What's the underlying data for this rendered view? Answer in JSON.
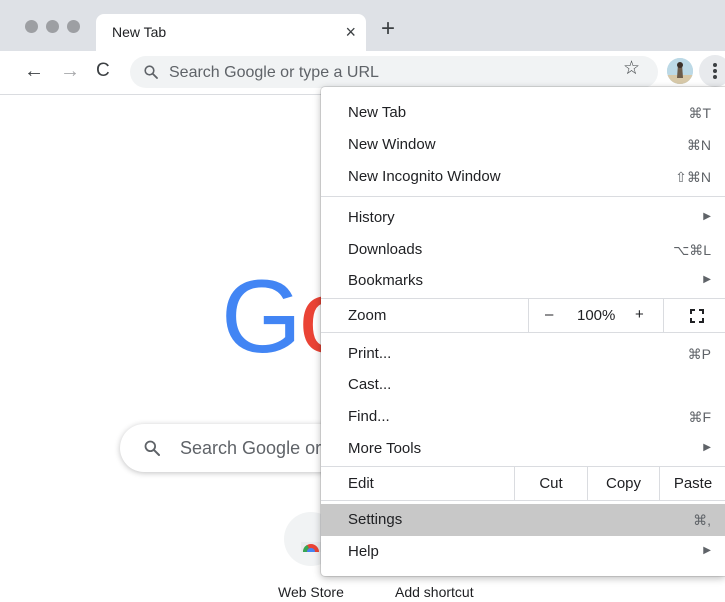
{
  "tab": {
    "title": "New Tab",
    "close": "×",
    "new_tab": "+"
  },
  "toolbar": {
    "back": "←",
    "forward": "→",
    "reload": "C",
    "omnibox_placeholder": "Search Google or type a URL",
    "star": "☆"
  },
  "ntp": {
    "logo_letters": [
      "G",
      "o"
    ],
    "search_placeholder": "Search Google or type a URL",
    "shortcuts": [
      {
        "label": "Web Store"
      },
      {
        "label": "Add shortcut"
      }
    ]
  },
  "menu": {
    "group1": [
      {
        "label": "New Tab",
        "shortcut": "⌘T"
      },
      {
        "label": "New Window",
        "shortcut": "⌘N"
      },
      {
        "label": "New Incognito Window",
        "shortcut": "⇧⌘N"
      }
    ],
    "group2": [
      {
        "label": "History",
        "arrow": "▶"
      },
      {
        "label": "Downloads",
        "shortcut": "⌥⌘L"
      },
      {
        "label": "Bookmarks",
        "arrow": "▶"
      }
    ],
    "zoom": {
      "label": "Zoom",
      "minus": "–",
      "value": "100%",
      "plus": "+"
    },
    "group3": [
      {
        "label": "Print...",
        "shortcut": "⌘P"
      },
      {
        "label": "Cast..."
      },
      {
        "label": "Find...",
        "shortcut": "⌘F"
      },
      {
        "label": "More Tools",
        "arrow": "▶"
      }
    ],
    "edit": {
      "label": "Edit",
      "cut": "Cut",
      "copy": "Copy",
      "paste": "Paste"
    },
    "group4": [
      {
        "label": "Settings",
        "shortcut": "⌘,",
        "highlighted": true
      },
      {
        "label": "Help",
        "arrow": "▶"
      }
    ]
  },
  "colors": {
    "tabstrip": "#dee1e6",
    "menu_highlight": "#c8c8c8",
    "google_blue": "#4285f4",
    "google_red": "#ea4335"
  },
  "icons": [
    "search-icon",
    "star-icon",
    "avatar",
    "more-vert-icon",
    "fullscreen-icon",
    "chrome-web-store-icon"
  ]
}
